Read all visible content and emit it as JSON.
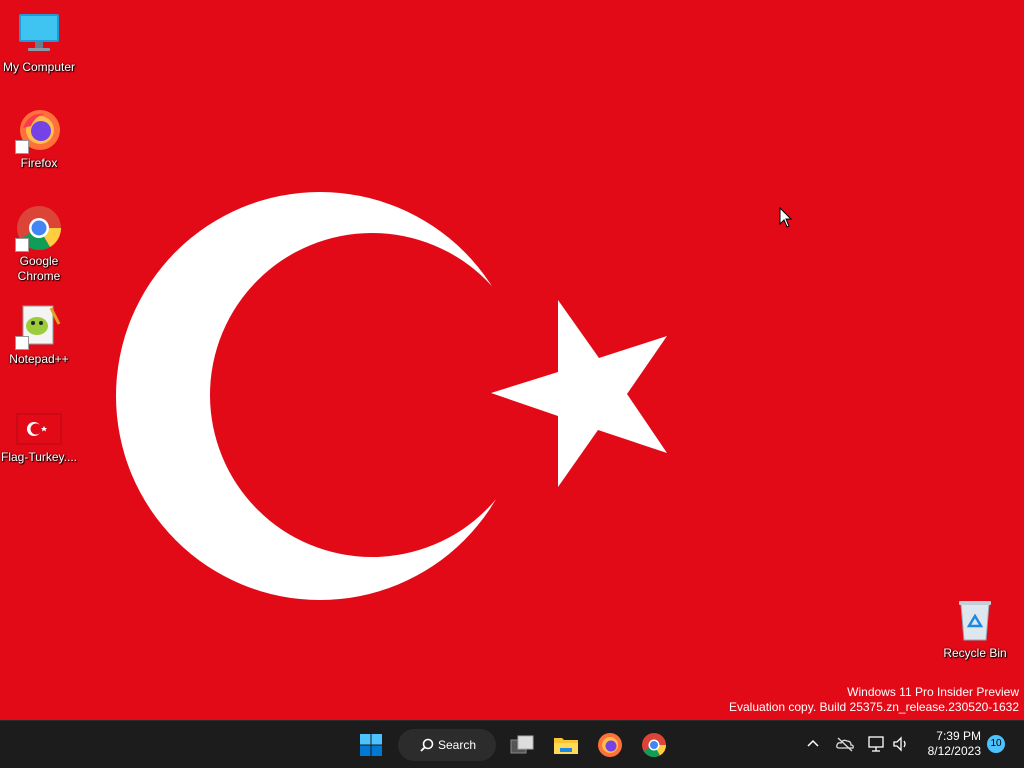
{
  "desktop": {
    "background": "#E30A17",
    "icons": [
      {
        "label": "My Computer",
        "icon": "computer-icon"
      },
      {
        "label": "Firefox",
        "icon": "firefox-icon"
      },
      {
        "label": "Google Chrome",
        "icon": "chrome-icon"
      },
      {
        "label": "Notepad++",
        "icon": "notepad-plus-plus-icon"
      },
      {
        "label": "Flag-Turkey....",
        "icon": "image-file-icon"
      }
    ],
    "recycle_bin": {
      "label": "Recycle Bin",
      "icon": "recycle-bin-icon"
    }
  },
  "watermark": {
    "line1": "Windows 11 Pro Insider Preview",
    "line2": "Evaluation copy. Build 25375.zn_release.230520-1632"
  },
  "taskbar": {
    "background": "#1c1c1c",
    "start_icon": "windows-start-icon",
    "search_label": "Search",
    "pinned": [
      "task-view-icon",
      "file-explorer-icon",
      "firefox-icon",
      "chrome-icon"
    ],
    "tray": [
      "chevron-up-icon",
      "onedrive-offline-icon",
      "network-icon",
      "volume-icon"
    ],
    "clock": {
      "time": "7:39 PM",
      "date": "8/12/2023"
    },
    "notification_count": "10",
    "notification_color": "#4cc2ff"
  }
}
